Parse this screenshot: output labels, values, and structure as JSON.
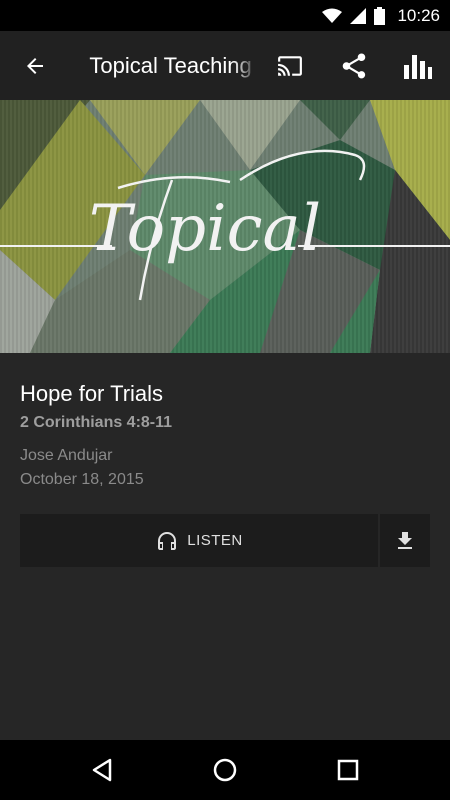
{
  "status_bar": {
    "time": "10:26"
  },
  "app_bar": {
    "title": "Topical Teaching"
  },
  "banner": {
    "text": "Topical"
  },
  "sermon": {
    "title": "Hope for Trials",
    "scripture": "2 Corinthians 4:8-11",
    "speaker": "Jose Andujar",
    "date": "October 18, 2015"
  },
  "actions": {
    "listen_label": "LISTEN"
  },
  "colors": {
    "app_bar": "#212121",
    "background": "#262626",
    "button": "#1c1c1c"
  }
}
